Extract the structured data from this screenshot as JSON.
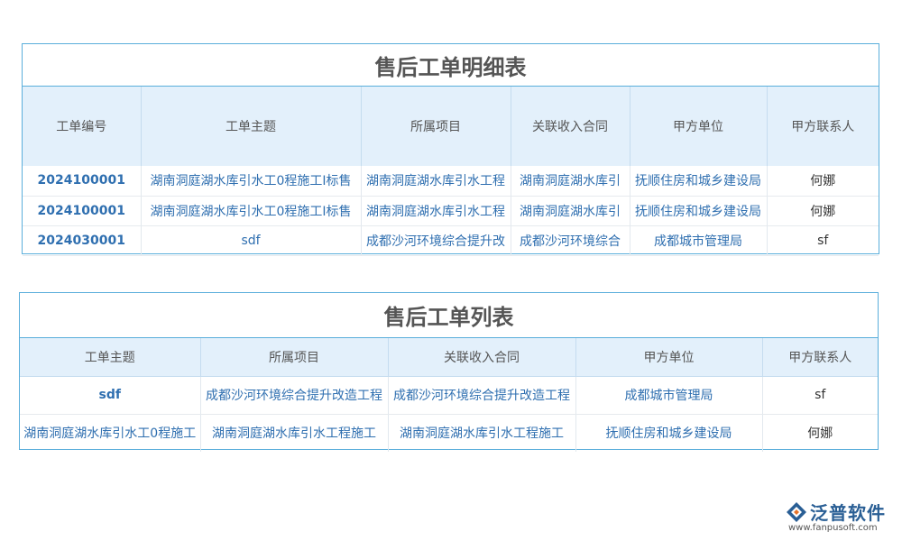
{
  "detail_table": {
    "title": "售后工单明细表",
    "headers": [
      "工单编号",
      "工单主题",
      "所属项目",
      "关联收入合同",
      "甲方单位",
      "甲方联系人"
    ],
    "rows": [
      [
        "2024100001",
        "湖南洞庭湖水库引水工0程施工I标售",
        "湖南洞庭湖水库引水工程",
        "湖南洞庭湖水库引",
        "抚顺住房和城乡建设局",
        "何娜"
      ],
      [
        "2024100001",
        "湖南洞庭湖水库引水工0程施工I标售",
        "湖南洞庭湖水库引水工程",
        "湖南洞庭湖水库引",
        "抚顺住房和城乡建设局",
        "何娜"
      ],
      [
        "2024030001",
        "sdf",
        "成都沙河环境综合提升改",
        "成都沙河环境综合",
        "成都城市管理局",
        "sf"
      ]
    ]
  },
  "list_table": {
    "title": "售后工单列表",
    "headers": [
      "工单主题",
      "所属项目",
      "关联收入合同",
      "甲方单位",
      "甲方联系人"
    ],
    "rows": [
      [
        "sdf",
        "成都沙河环境综合提升改造工程",
        "成都沙河环境综合提升改造工程",
        "成都城市管理局",
        "sf"
      ],
      [
        "湖南洞庭湖水库引水工0程施工",
        "湖南洞庭湖水库引水工程施工",
        "湖南洞庭湖水库引水工程施工",
        "抚顺住房和城乡建设局",
        "何娜"
      ]
    ]
  },
  "logo": {
    "name": "泛普软件",
    "url": "www.fanpusoft.com"
  },
  "colors": {
    "border": "#5aaedb",
    "header_bg": "#e3f0fb",
    "link_text": "#2f6fb0",
    "title_text": "#555555"
  }
}
